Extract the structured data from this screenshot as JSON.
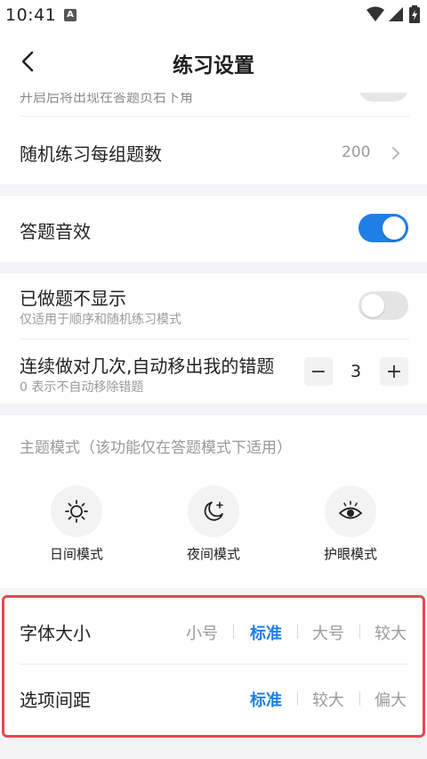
{
  "status_bar": {
    "time": "10:41",
    "notification_letter": "A"
  },
  "nav": {
    "title": "练习设置",
    "back_icon": "chevron-left-icon"
  },
  "partial_row": {
    "text": "开启后将出现在答题页右下角"
  },
  "random_practice": {
    "title": "随机练习每组题数",
    "value": "200"
  },
  "answer_sound": {
    "title": "答题音效",
    "enabled": true
  },
  "hide_done": {
    "title": "已做题不显示",
    "subtitle": "仅适用于顺序和随机练习模式",
    "enabled": false
  },
  "auto_remove": {
    "title": "连续做对几次,自动移出我的错题",
    "subtitle": "0 表示不自动移除错题",
    "value": "3",
    "minus": "−",
    "plus": "+"
  },
  "theme": {
    "label": "主题模式（该功能仅在答题模式下适用）",
    "modes": [
      {
        "name": "日间模式",
        "icon": "sun-icon"
      },
      {
        "name": "夜间模式",
        "icon": "moon-icon"
      },
      {
        "name": "护眼模式",
        "icon": "eye-icon"
      }
    ]
  },
  "font_size": {
    "title": "字体大小",
    "options": [
      "小号",
      "标准",
      "大号",
      "较大"
    ],
    "selected": "标准"
  },
  "option_spacing": {
    "title": "选项间距",
    "options": [
      "标准",
      "较大",
      "偏大"
    ],
    "selected": "标准"
  },
  "colors": {
    "accent": "#1f7fe5",
    "highlight_border": "#e8474f",
    "gap": "#f4f4f6"
  }
}
